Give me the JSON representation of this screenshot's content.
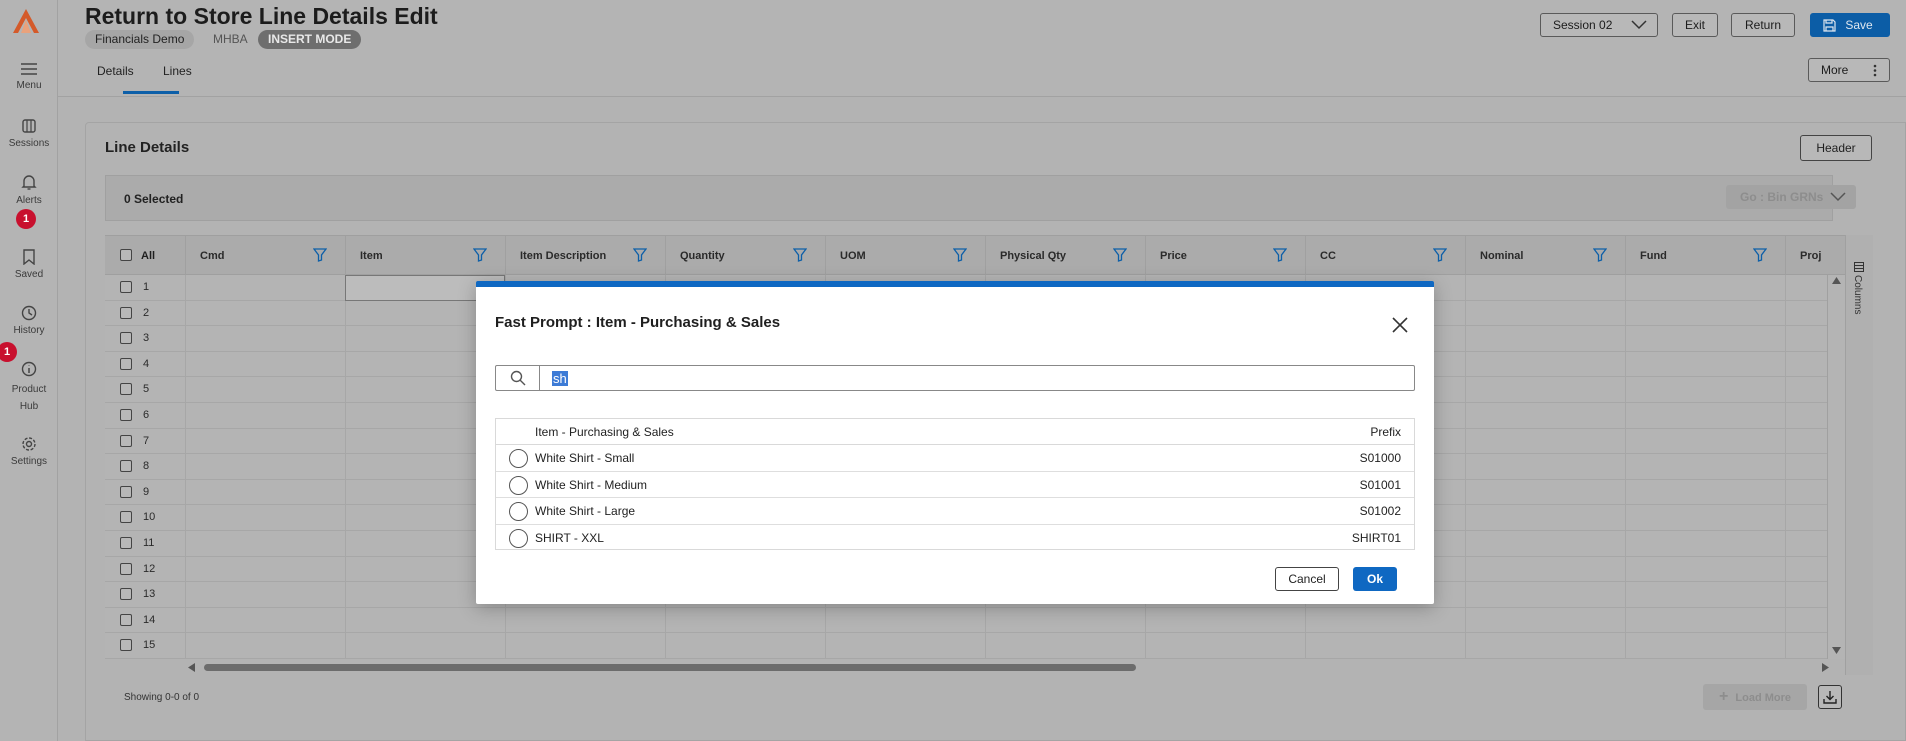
{
  "nav": {
    "items": [
      {
        "label": "Menu",
        "icon": "menu-icon"
      },
      {
        "label": "Sessions",
        "icon": "sessions-icon"
      },
      {
        "label": "Alerts",
        "icon": "bell-icon",
        "badge": "1"
      },
      {
        "label": "Saved",
        "icon": "bookmark-icon"
      },
      {
        "label": "History",
        "icon": "clock-icon",
        "badge": "1"
      },
      {
        "label": "Product Hub",
        "icon": "info-icon"
      },
      {
        "label": "Settings",
        "icon": "gear-icon"
      }
    ]
  },
  "header": {
    "title": "Return to Store Line Details Edit",
    "company": "Financials Demo",
    "code": "MHBA",
    "mode": "INSERT MODE",
    "tabs": [
      "Details",
      "Lines"
    ],
    "active_tab": "Lines",
    "session": "Session 02",
    "exit": "Exit",
    "return": "Return",
    "save": "Save",
    "more": "More"
  },
  "lines": {
    "title": "Line Details",
    "header_button": "Header",
    "selected": "0 Selected",
    "goto": "Go : Bin GRNs",
    "all_label": "All",
    "columns": [
      "Cmd",
      "Item",
      "Item Description",
      "Quantity",
      "UOM",
      "Physical Qty",
      "Price",
      "CC",
      "Nominal",
      "Fund",
      "Proj"
    ],
    "rows": [
      "1",
      "2",
      "3",
      "4",
      "5",
      "6",
      "7",
      "8",
      "9",
      "10",
      "11",
      "12",
      "13",
      "14",
      "15"
    ],
    "columns_panel": "Columns",
    "showing": "Showing 0-0 of 0",
    "load_more": "Load More"
  },
  "modal": {
    "title": "Fast Prompt : Item - Purchasing & Sales",
    "search_value": "sh",
    "list_header": "Item - Purchasing & Sales",
    "list_header_code": "Prefix",
    "items": [
      {
        "name": "White Shirt - Small",
        "code": "S01000"
      },
      {
        "name": "White Shirt - Medium",
        "code": "S01001"
      },
      {
        "name": "White Shirt - Large",
        "code": "S01002"
      },
      {
        "name": "SHIRT - XXL",
        "code": "SHIRT01"
      }
    ],
    "cancel": "Cancel",
    "ok": "Ok"
  },
  "colors": {
    "accent": "#0f68c2",
    "badge": "#c8102e",
    "overlay_gray": "#b3b3b3"
  }
}
